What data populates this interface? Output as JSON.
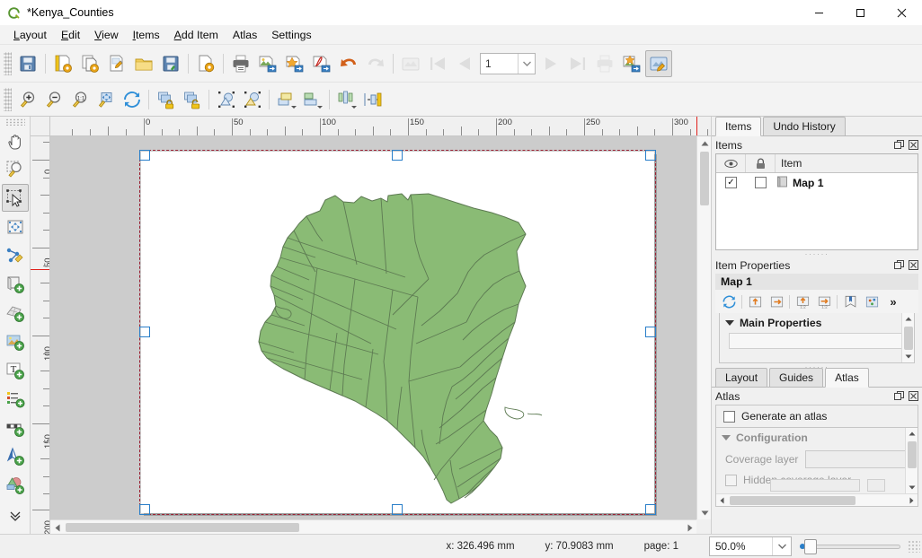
{
  "window": {
    "title": "*Kenya_Counties",
    "app_icon": "qgis-logo-icon",
    "controls": {
      "minimize": "—",
      "maximize": "☐",
      "close": "✕"
    }
  },
  "menubar": {
    "items": [
      {
        "label": "Layout",
        "mnemonic": "L"
      },
      {
        "label": "Edit",
        "mnemonic": "E"
      },
      {
        "label": "View",
        "mnemonic": "V"
      },
      {
        "label": "Items",
        "mnemonic": "I"
      },
      {
        "label": "Add Item",
        "mnemonic": "A"
      },
      {
        "label": "Atlas",
        "mnemonic": ""
      },
      {
        "label": "Settings",
        "mnemonic": ""
      }
    ]
  },
  "toolbar_layout": {
    "buttons": [
      {
        "name": "save-project-icon",
        "tip": "Save Project"
      },
      {
        "name": "new-layout-icon",
        "tip": "New Layout"
      },
      {
        "name": "duplicate-layout-icon",
        "tip": "Duplicate Layout"
      },
      {
        "name": "layout-manager-icon",
        "tip": "Layout Manager"
      },
      {
        "name": "open-template-icon",
        "tip": "Add Items from Template"
      },
      {
        "name": "save-template-icon",
        "tip": "Save as Template"
      },
      {
        "name": "layout-properties-icon",
        "tip": "Layout Properties"
      },
      {
        "name": "print-layout-icon",
        "tip": "Print Layout"
      },
      {
        "name": "export-image-icon",
        "tip": "Export as Image"
      },
      {
        "name": "export-svg-icon",
        "tip": "Export as SVG"
      },
      {
        "name": "export-pdf-icon",
        "tip": "Export as PDF"
      }
    ]
  },
  "toolbar_atlas": {
    "undo": {
      "name": "undo-icon",
      "enabled": true
    },
    "redo": {
      "name": "redo-icon",
      "enabled": false
    },
    "preview_atlas": {
      "name": "atlas-preview-icon",
      "enabled": false
    },
    "first": {
      "name": "atlas-first-feature-icon",
      "enabled": false
    },
    "previous": {
      "name": "atlas-previous-feature-icon",
      "enabled": false
    },
    "page_value": "1",
    "next": {
      "name": "atlas-next-feature-icon",
      "enabled": false
    },
    "last": {
      "name": "atlas-last-feature-icon",
      "enabled": false
    },
    "print_atlas": {
      "name": "atlas-print-icon",
      "enabled": false
    },
    "export_atlas_image": {
      "name": "atlas-export-image-icon",
      "enabled": true
    },
    "atlas_settings": {
      "name": "atlas-settings-icon",
      "enabled": true,
      "active": true
    }
  },
  "toolbar_navigation": {
    "buttons": [
      {
        "name": "zoom-in-icon"
      },
      {
        "name": "zoom-out-icon"
      },
      {
        "name": "zoom-actual-size-icon"
      },
      {
        "name": "zoom-full-icon"
      },
      {
        "name": "refresh-view-icon"
      },
      {
        "name": "lock-items-icon"
      },
      {
        "name": "unlock-all-items-icon"
      },
      {
        "name": "group-items-icon"
      },
      {
        "name": "ungroup-items-icon"
      },
      {
        "name": "raise-items-icon"
      },
      {
        "name": "lower-items-icon"
      },
      {
        "name": "align-items-icon"
      },
      {
        "name": "distribute-items-icon"
      },
      {
        "name": "resize-items-icon"
      }
    ]
  },
  "left_toolbox": {
    "tools": [
      {
        "name": "pan-layout-tool",
        "label": "Pan Layout",
        "active": false
      },
      {
        "name": "zoom-tool",
        "label": "Zoom",
        "active": false
      },
      {
        "name": "select-move-item-tool",
        "label": "Select/Move Item",
        "active": true
      },
      {
        "name": "move-item-content-tool",
        "label": "Move Item Content",
        "active": false
      },
      {
        "name": "edit-nodes-tool",
        "label": "Edit Nodes Item",
        "active": false
      },
      {
        "name": "add-map-tool",
        "label": "Add Map",
        "active": false
      },
      {
        "name": "add-3d-map-tool",
        "label": "Add 3D Map",
        "active": false
      },
      {
        "name": "add-picture-tool",
        "label": "Add Picture",
        "active": false
      },
      {
        "name": "add-label-tool",
        "label": "Add Label",
        "active": false
      },
      {
        "name": "add-legend-tool",
        "label": "Add Legend",
        "active": false
      },
      {
        "name": "add-scalebar-tool",
        "label": "Add Scale Bar",
        "active": false
      },
      {
        "name": "add-north-arrow-tool",
        "label": "Add North Arrow",
        "active": false
      },
      {
        "name": "add-shape-tool",
        "label": "Add Shape",
        "active": false
      }
    ],
    "overflow": "»"
  },
  "rulers": {
    "horizontal": {
      "labels": [
        "0",
        "50",
        "100",
        "150",
        "200",
        "250",
        "300"
      ],
      "unit": "mm",
      "tick_step": 10,
      "label_step": 50
    },
    "vertical": {
      "labels": [
        "0",
        "50",
        "100",
        "150",
        "200"
      ],
      "unit": "mm",
      "tick_step": 10,
      "label_step": 50
    },
    "guide_color": "#e0201b"
  },
  "canvas": {
    "page_background": "#ffffff",
    "workspace_background": "#cccccc",
    "selection_border_colors": [
      "#2e7fd0",
      "#9d1f2f"
    ],
    "map_item": {
      "name": "Map 1",
      "fill_color": "#8ABB75",
      "stroke_color": "#5d7a52",
      "selected": true
    }
  },
  "panels": {
    "top_tabs": [
      {
        "label": "Items",
        "selected": true
      },
      {
        "label": "Undo History",
        "selected": false
      }
    ],
    "items_panel": {
      "title": "Items",
      "columns": {
        "visibility": "eye-icon",
        "lock": "lock-icon",
        "item": "Item"
      },
      "rows": [
        {
          "name": "Map 1",
          "visible": true,
          "locked": false,
          "icon": "map-item-icon"
        }
      ]
    },
    "item_properties_panel": {
      "title": "Item Properties",
      "selected_item": "Map 1",
      "toolbar": [
        {
          "name": "refresh-map-icon"
        },
        {
          "name": "set-map-extent-to-canvas-icon"
        },
        {
          "name": "set-canvas-extent-to-map-icon"
        },
        {
          "name": "set-map-scale-to-canvas-icon"
        },
        {
          "name": "set-canvas-scale-to-map-icon"
        },
        {
          "name": "bookmarks-icon"
        },
        {
          "name": "map-themes-icon"
        },
        {
          "name": "more-options-icon",
          "label": "»"
        }
      ],
      "sections": [
        {
          "label": "Main Properties",
          "expanded": true
        }
      ]
    },
    "bottom_tabs": [
      {
        "label": "Layout",
        "selected": false
      },
      {
        "label": "Guides",
        "selected": false
      },
      {
        "label": "Atlas",
        "selected": true
      }
    ],
    "atlas_panel": {
      "title": "Atlas",
      "generate_atlas": {
        "label": "Generate an atlas",
        "checked": false
      },
      "configuration": {
        "label": "Configuration",
        "expanded": true
      },
      "coverage_layer": {
        "label": "Coverage layer",
        "value": "",
        "enabled": false
      },
      "hidden_coverage_layer": {
        "label": "Hidden coverage layer",
        "checked": false,
        "enabled": false
      }
    },
    "dock_buttons": {
      "float": "float-icon",
      "close": "close-icon"
    }
  },
  "statusbar": {
    "cursor_x": "x: 326.496 mm",
    "cursor_y": "y: 70.9083 mm",
    "page": "page: 1",
    "zoom_value": "50.0%",
    "zoom_slider_percent": 8
  }
}
